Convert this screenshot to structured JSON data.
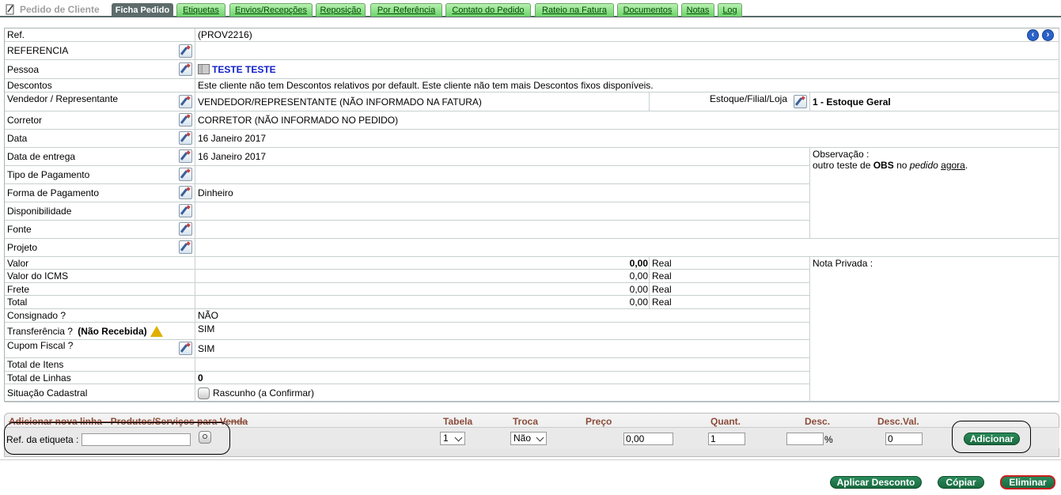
{
  "header": {
    "title": "Pedido de Cliente",
    "tabs": [
      "Ficha Pedido",
      "Etiquetas",
      "Envios/Recepções",
      "Reposição",
      "Por Referência",
      "Contato do Pedido",
      "Rateio na Fatura",
      "Documentos",
      "Notas",
      "Log"
    ]
  },
  "fields": {
    "ref_label": "Ref.",
    "ref_value": "(PROV2216)",
    "referencia_label": "REFERENCIA",
    "pessoa_label": "Pessoa",
    "pessoa_value": "TESTE TESTE",
    "descontos_label": "Descontos",
    "descontos_value": "Este cliente não tem Descontos relativos por default. Este cliente não tem mais Descontos fixos disponíveis.",
    "vendedor_label": "Vendedor / Representante",
    "vendedor_value": "VENDEDOR/REPRESENTANTE (NÃO INFORMADO NA FATURA)",
    "estoque_label": "Estoque/Filial/Loja",
    "estoque_value": "1 - Estoque Geral",
    "corretor_label": "Corretor",
    "corretor_value": "CORRETOR (NÃO INFORMADO NO PEDIDO)",
    "data_label": "Data",
    "data_value": "16 Janeiro 2017",
    "entrega_label": "Data de entrega",
    "entrega_value": "16 Janeiro 2017",
    "observacao_label": "Observação :",
    "observacao_pre": "outro teste de ",
    "observacao_bold": "OBS",
    "observacao_mid": " no ",
    "observacao_it": "pedido",
    "observacao_sp": " ",
    "observacao_ul": "agora",
    "observacao_end": ".",
    "tipo_pag_label": "Tipo de Pagamento",
    "forma_pag_label": "Forma de Pagamento",
    "forma_pag_value": "Dinheiro",
    "disp_label": "Disponibilidade",
    "fonte_label": "Fonte",
    "projeto_label": "Projeto",
    "valor_label": "Valor",
    "valor_value": "0,00",
    "valor_cur": "Real",
    "icms_label": "Valor do ICMS",
    "icms_value": "0,00",
    "icms_cur": "Real",
    "frete_label": "Frete",
    "frete_value": "0,00",
    "frete_cur": "Real",
    "total_label": "Total",
    "total_value": "0,00",
    "total_cur": "Real",
    "nota_privada_label": "Nota Privada :",
    "consignado_label": "Consignado ?",
    "consignado_value": "NÃO",
    "transf_label": "Transferência ?",
    "transf_note": "(Não Recebida)",
    "transf_value": "SIM",
    "cupom_label": "Cupom Fiscal ?",
    "cupom_value": "SIM",
    "total_itens_label": "Total de Itens",
    "total_linhas_label": "Total de Linhas",
    "total_linhas_value": "0",
    "situacao_label": "Situação Cadastral",
    "situacao_value": "Rascunho (a Confirmar)"
  },
  "addline": {
    "title": "Adicionar nova linha - Produtos/Serviços para Venda",
    "col_tabela": "Tabela",
    "col_troca": "Troca",
    "col_preco": "Preço",
    "col_quant": "Quant.",
    "col_desc": "Desc.",
    "col_descval": "Desc.Val.",
    "ref_label": "Ref. da etiqueta :",
    "ref_value": "",
    "tabela_value": "1",
    "troca_value": "Não",
    "preco_value": "0,00",
    "quant_value": "1",
    "desc_value": "",
    "desc_unit": "%",
    "descval_value": "0",
    "add_button": "Adicionar"
  },
  "actions": {
    "aplicar": "Aplicar Desconto",
    "copiar": "Cópiar",
    "eliminar": "Eliminar"
  }
}
